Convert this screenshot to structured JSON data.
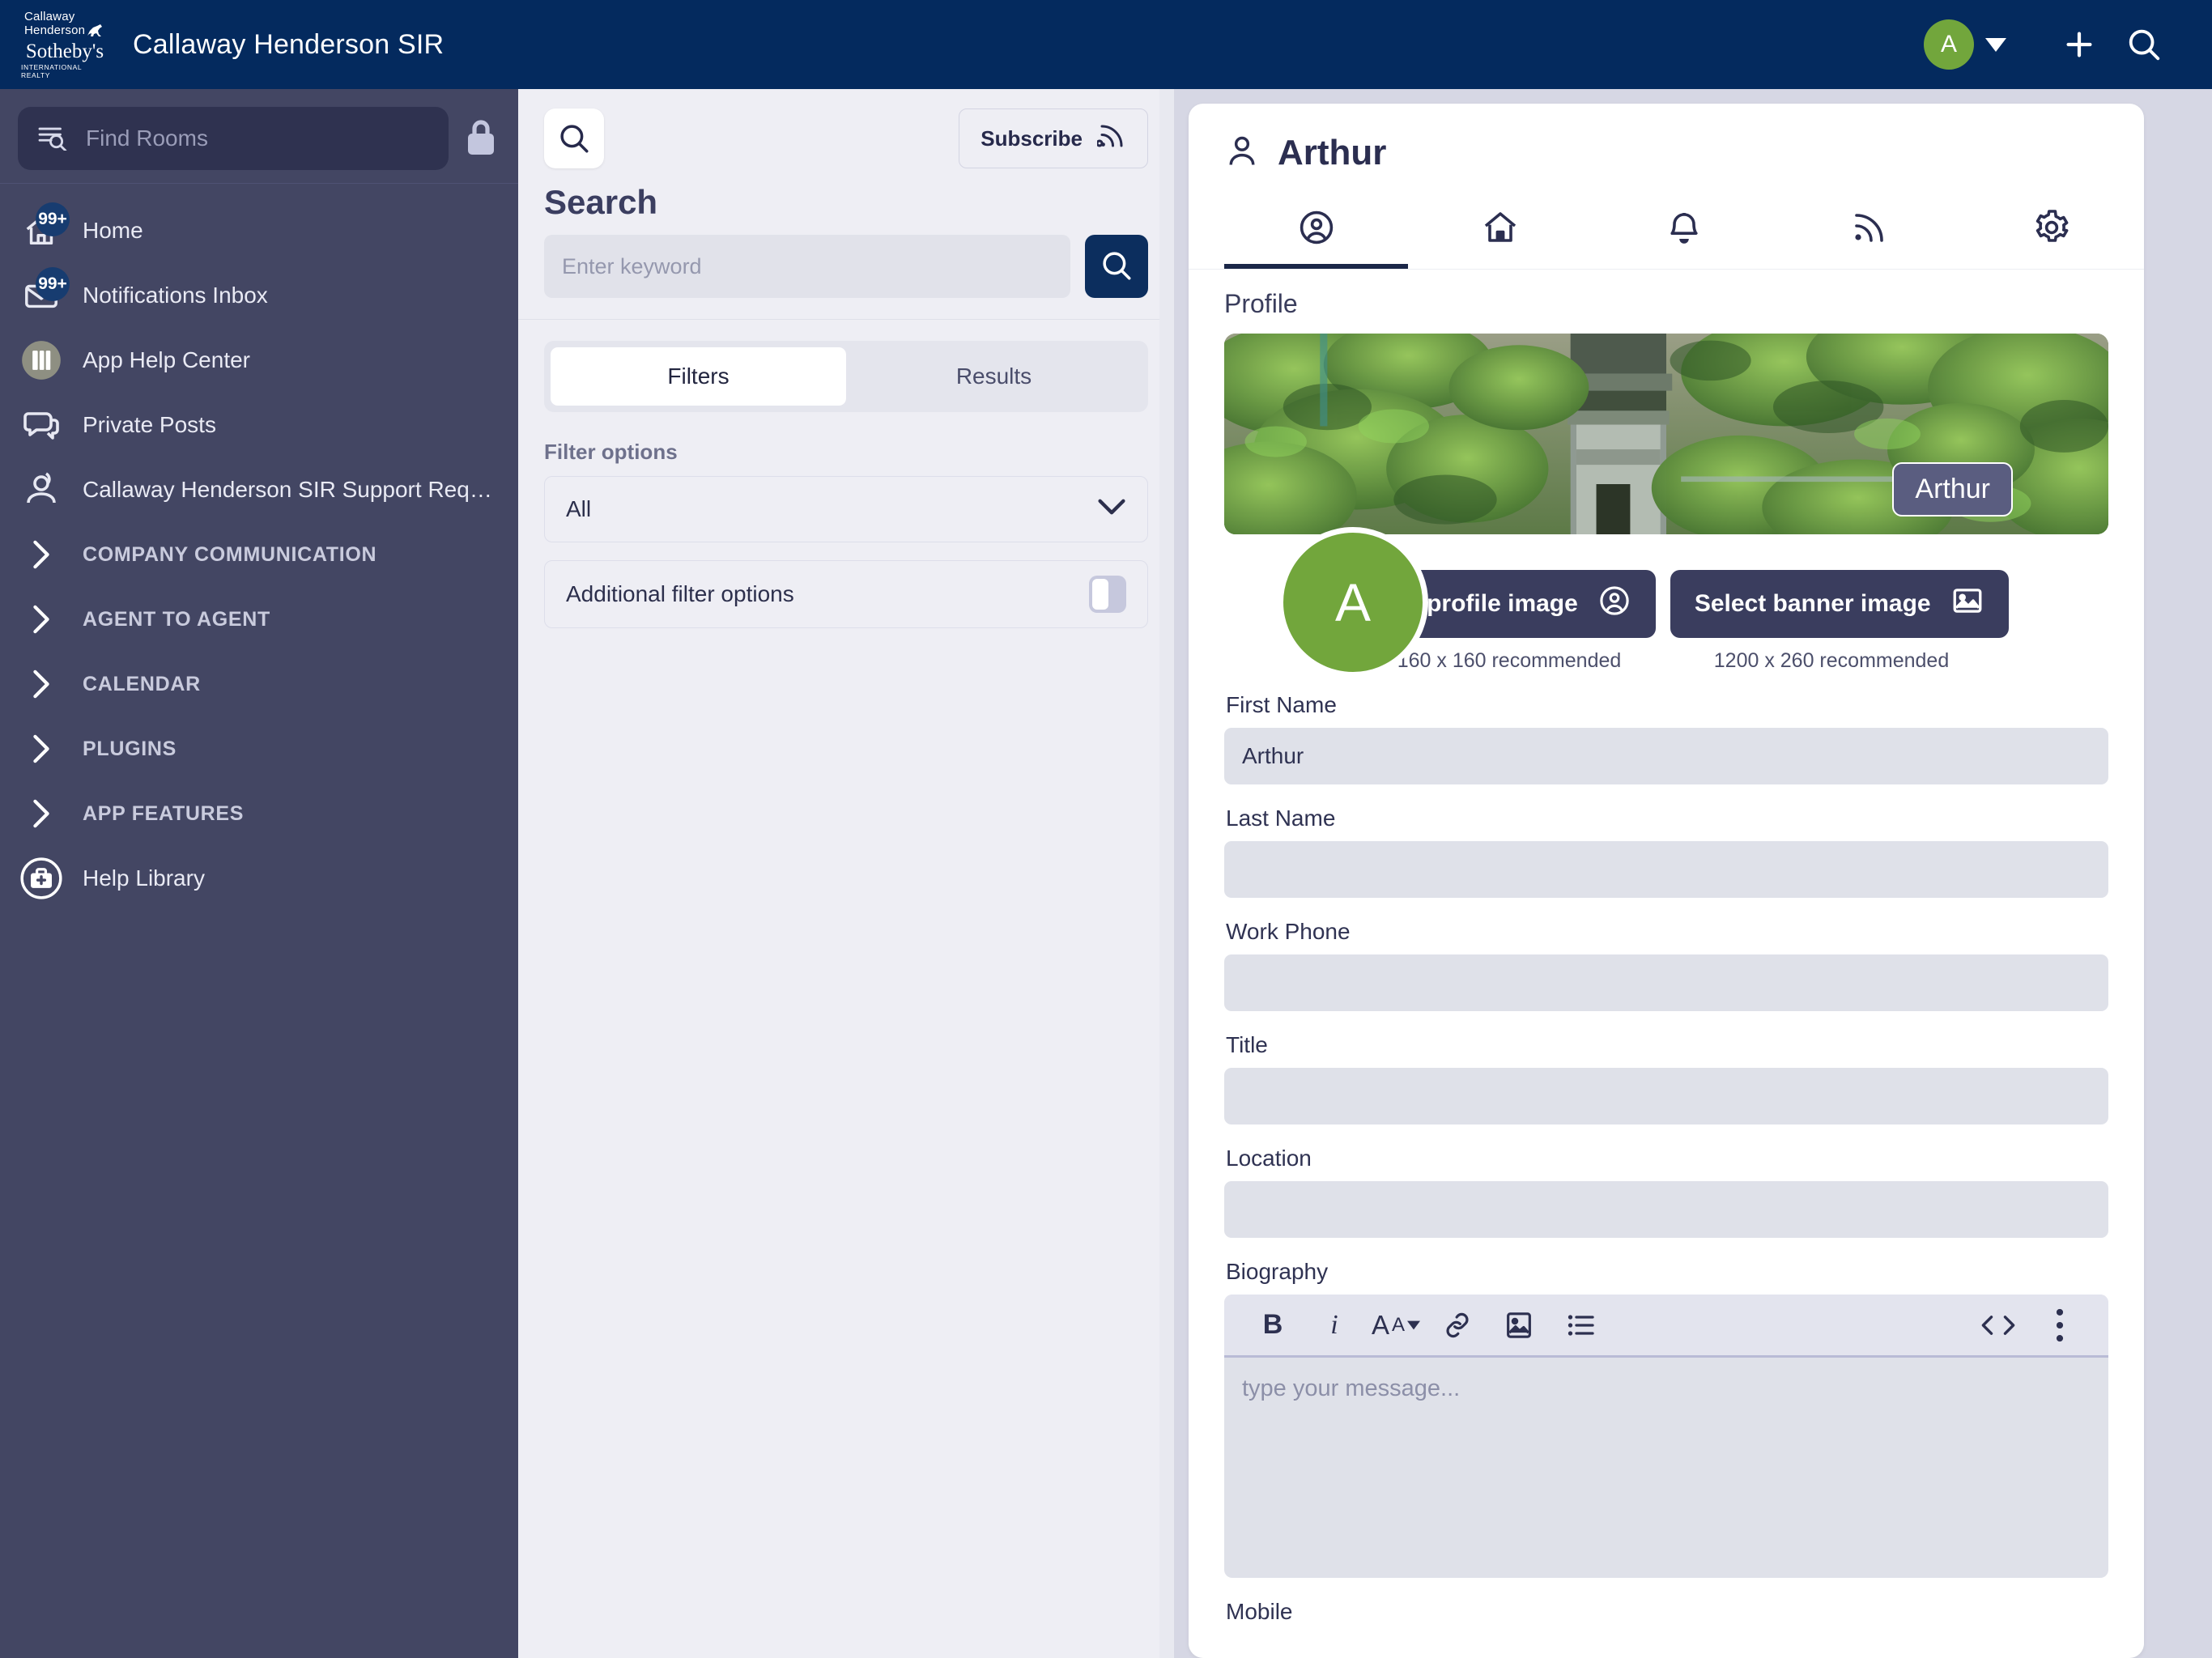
{
  "topbar": {
    "logo": {
      "line1": "Callaway",
      "line2": "Henderson",
      "brand": "Sotheby's",
      "tagline": "INTERNATIONAL REALTY",
      "horse_icon": "horse-icon"
    },
    "title": "Callaway Henderson SIR",
    "avatar_initial": "A",
    "icons": {
      "caret": "chevron-down-icon",
      "add": "plus-icon",
      "search": "search-icon"
    }
  },
  "sidebar": {
    "search_placeholder": "Find Rooms",
    "search_icon": "rooms-search-icon",
    "lock_icon": "lock-icon",
    "items": [
      {
        "label": "Home",
        "icon": "home-icon",
        "badge": "99+"
      },
      {
        "label": "Notifications Inbox",
        "icon": "envelope-icon",
        "badge": "99+"
      },
      {
        "label": "App Help Center",
        "icon": "books-icon",
        "badge": ""
      },
      {
        "label": "Private Posts",
        "icon": "chat-bubbles-icon",
        "badge": ""
      },
      {
        "label": "Callaway Henderson SIR Support Requ…",
        "icon": "support-agent-icon",
        "badge": ""
      }
    ],
    "sections": [
      {
        "label": "COMPANY COMMUNICATION",
        "icon": "chevron-right-icon"
      },
      {
        "label": "AGENT TO AGENT",
        "icon": "chevron-right-icon"
      },
      {
        "label": "CALENDAR",
        "icon": "chevron-right-icon"
      },
      {
        "label": "PLUGINS",
        "icon": "chevron-right-icon"
      },
      {
        "label": "APP FEATURES",
        "icon": "chevron-right-icon"
      }
    ],
    "help": {
      "label": "Help Library",
      "icon": "briefcase-medical-icon"
    }
  },
  "search_panel": {
    "header_icon": "search-icon",
    "subscribe_label": "Subscribe",
    "subscribe_icon": "rss-icon",
    "title": "Search",
    "input_value": "",
    "input_placeholder": "Enter keyword",
    "search_button_icon": "search-icon",
    "tabs": [
      {
        "label": "Filters",
        "active": true
      },
      {
        "label": "Results",
        "active": false
      }
    ],
    "filter_options_label": "Filter options",
    "filter_select_value": "All",
    "filter_select_icon": "chevron-down-icon",
    "additional_filter_label": "Additional filter options",
    "additional_filter_on": false
  },
  "profile_panel": {
    "header_icon": "person-icon",
    "header_title": "Arthur",
    "tabs": [
      {
        "icon": "profile-circle-icon",
        "active": true
      },
      {
        "icon": "home-icon",
        "active": false
      },
      {
        "icon": "bell-icon",
        "active": false
      },
      {
        "icon": "rss-icon",
        "active": false
      },
      {
        "icon": "gear-icon",
        "active": false
      }
    ],
    "section_label": "Profile",
    "banner_name_badge": "Arthur",
    "avatar_initial": "A",
    "select_profile_image_label": "Select profile image",
    "select_profile_image_icon": "profile-circle-icon",
    "select_banner_image_label": "Select banner image",
    "select_banner_image_icon": "image-icon",
    "profile_image_hint": "160 x 160 recommended",
    "banner_image_hint": "1200 x 260 recommended",
    "fields": [
      {
        "label": "First Name",
        "value": "Arthur"
      },
      {
        "label": "Last Name",
        "value": ""
      },
      {
        "label": "Work Phone",
        "value": ""
      },
      {
        "label": "Title",
        "value": ""
      },
      {
        "label": "Location",
        "value": ""
      }
    ],
    "biography": {
      "label": "Biography",
      "placeholder": "type your message...",
      "toolbar": [
        {
          "icon": "bold-icon",
          "glyph": "B"
        },
        {
          "icon": "italic-icon",
          "glyph": "i"
        },
        {
          "icon": "font-size-icon",
          "glyph": "AA"
        },
        {
          "icon": "link-icon",
          "glyph": ""
        },
        {
          "icon": "image-icon",
          "glyph": ""
        },
        {
          "icon": "bullet-list-icon",
          "glyph": ""
        },
        {
          "icon": "code-icon",
          "glyph": ""
        },
        {
          "icon": "more-vertical-icon",
          "glyph": ""
        }
      ]
    },
    "mobile_label": "Mobile"
  },
  "colors": {
    "header_navy": "#042a5e",
    "sidebar": "#434663",
    "panel_bg": "#eeeef4",
    "app_bg": "#d6d7e4",
    "accent_green": "#72a63c",
    "button_dark": "#3a3d5e"
  }
}
